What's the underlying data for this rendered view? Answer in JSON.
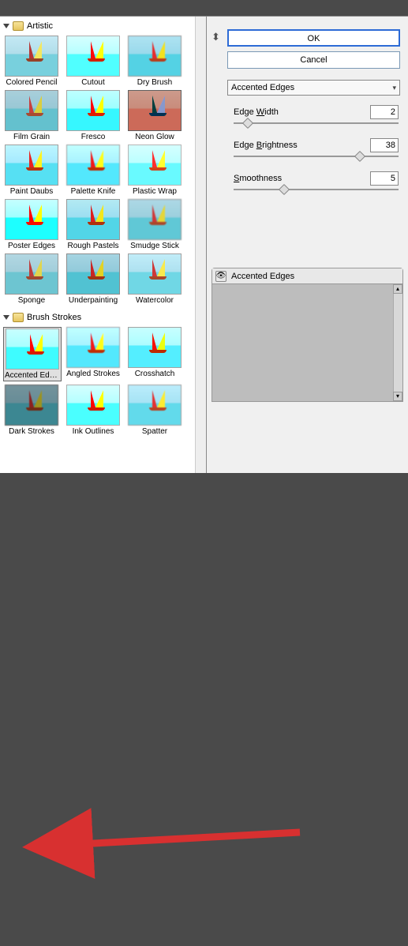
{
  "topbar": {},
  "buttons": {
    "ok": "OK",
    "cancel": "Cancel"
  },
  "filter_dropdown": {
    "selected": "Accented Edges"
  },
  "sliders": {
    "edge_width": {
      "label_pre": "Edge ",
      "label_u": "W",
      "label_post": "idth",
      "value": 2,
      "pos_pct": 6
    },
    "edge_brightness": {
      "label_pre": "Edge ",
      "label_u": "B",
      "label_post": "rightness",
      "value": 38,
      "pos_pct": 74
    },
    "smoothness": {
      "label_pre": "",
      "label_u": "S",
      "label_post": "moothness",
      "value": 5,
      "pos_pct": 28
    }
  },
  "layer_panel": {
    "active": "Accented Edges"
  },
  "folders": {
    "artistic": {
      "label": "Artistic"
    },
    "brush_strokes": {
      "label": "Brush Strokes"
    }
  },
  "artistic_filters": [
    {
      "name": "Colored Pencil",
      "fx": "fx-cp"
    },
    {
      "name": "Cutout",
      "fx": "fx-co"
    },
    {
      "name": "Dry Brush",
      "fx": "fx-db"
    },
    {
      "name": "Film Grain",
      "fx": "fx-fg"
    },
    {
      "name": "Fresco",
      "fx": "fx-fr"
    },
    {
      "name": "Neon Glow",
      "fx": "fx-ng"
    },
    {
      "name": "Paint Daubs",
      "fx": "fx-pd"
    },
    {
      "name": "Palette Knife",
      "fx": "fx-pk"
    },
    {
      "name": "Plastic Wrap",
      "fx": "fx-pw"
    },
    {
      "name": "Poster Edges",
      "fx": "fx-pe"
    },
    {
      "name": "Rough Pastels",
      "fx": "fx-rp"
    },
    {
      "name": "Smudge Stick",
      "fx": "fx-ss"
    },
    {
      "name": "Sponge",
      "fx": "fx-sp"
    },
    {
      "name": "Underpainting",
      "fx": "fx-up"
    },
    {
      "name": "Watercolor",
      "fx": "fx-wc"
    }
  ],
  "brush_filters": [
    {
      "name": "Accented Edges",
      "fx": "fx-ae",
      "selected": true
    },
    {
      "name": "Angled Strokes",
      "fx": "fx-as"
    },
    {
      "name": "Crosshatch",
      "fx": "fx-ch"
    },
    {
      "name": "Dark Strokes",
      "fx": "fx-ds"
    },
    {
      "name": "Ink Outlines",
      "fx": "fx-io"
    },
    {
      "name": "Spatter",
      "fx": "fx-spl"
    }
  ]
}
